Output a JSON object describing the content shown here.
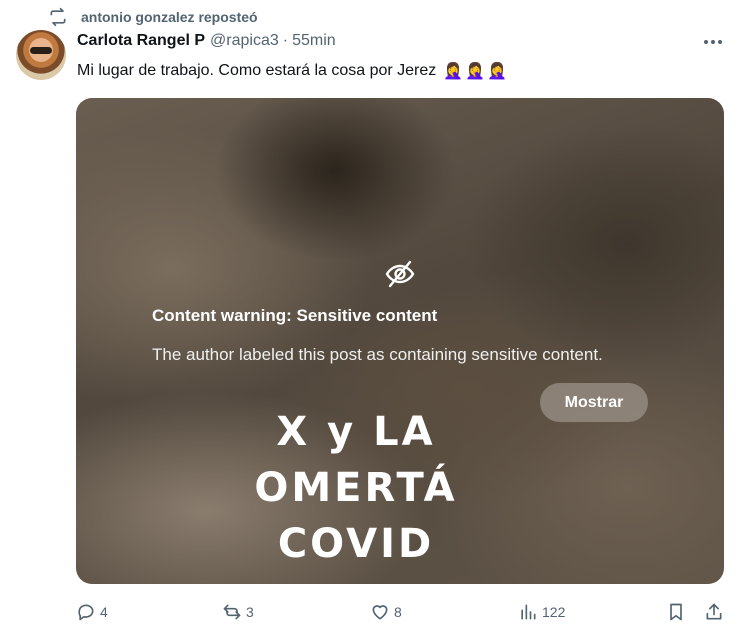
{
  "repost": {
    "icon": "repost-icon",
    "text": "antonio gonzalez reposteó"
  },
  "post": {
    "author": {
      "name": "Carlota Rangel P",
      "handle": "@rapica3",
      "separator": "·",
      "time": "55min",
      "avatar": "avatar"
    },
    "text": "Mi lugar de trabajo. Como estará la cosa por Jerez",
    "emojis": "🤦‍♀️🤦‍♀️🤦‍♀️",
    "more_icon": "more-icon"
  },
  "media": {
    "warning_icon": "eye-slash-icon",
    "warning_title": "Content warning: Sensitive content",
    "warning_description": "The author labeled this post as containing sensitive content.",
    "show_button": "Mostrar",
    "image_text_lines": [
      "X y LA",
      "OMERTÁ",
      "COVID"
    ]
  },
  "actions": {
    "replies": {
      "icon": "reply-icon",
      "count": "4"
    },
    "reposts": {
      "icon": "repost-icon",
      "count": "3"
    },
    "likes": {
      "icon": "like-icon",
      "count": "8"
    },
    "views": {
      "icon": "views-icon",
      "count": "122"
    },
    "bookmark": {
      "icon": "bookmark-icon"
    },
    "share": {
      "icon": "share-icon"
    }
  },
  "colors": {
    "secondary_text": "#536471",
    "primary_text": "#0f1419",
    "background": "#ffffff"
  }
}
